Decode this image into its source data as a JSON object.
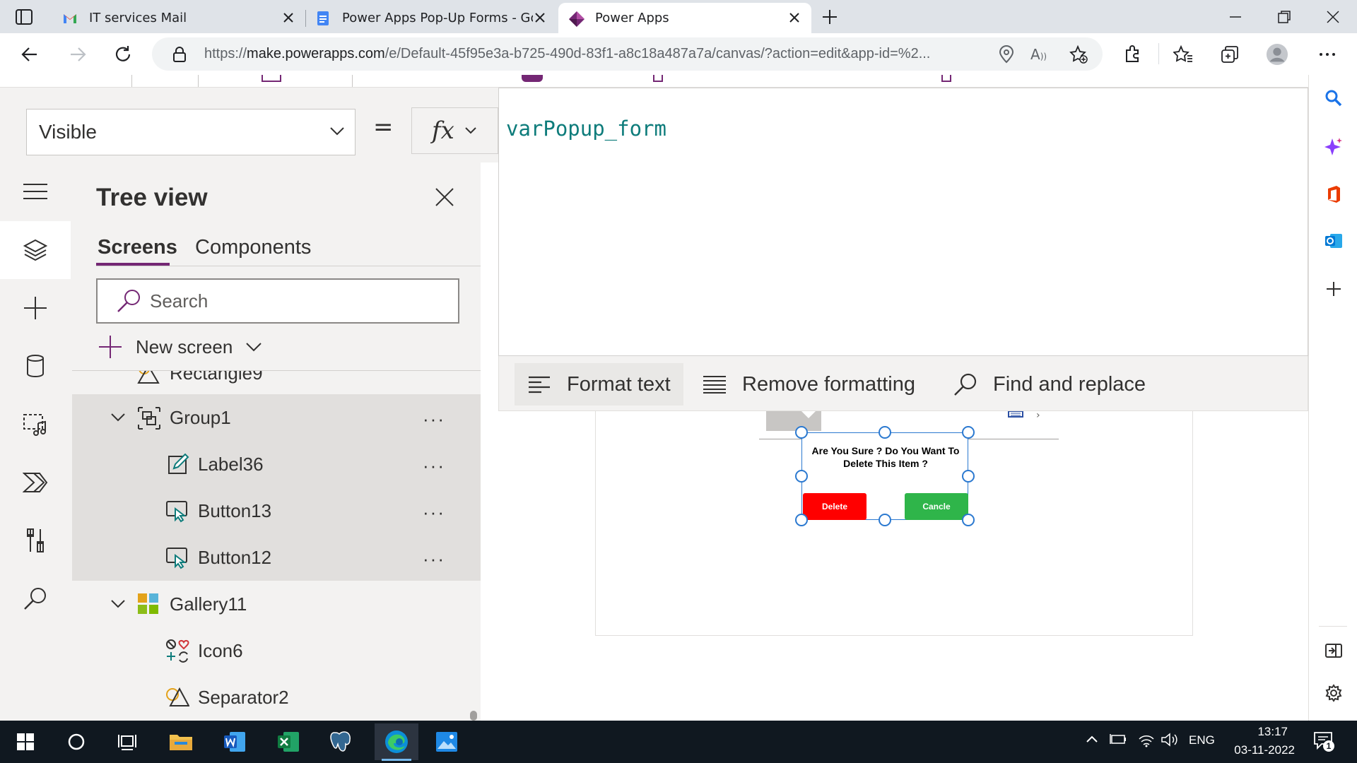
{
  "browser": {
    "tabs": [
      {
        "title": "IT services Mail",
        "icon": "gmail-icon"
      },
      {
        "title": "Power Apps Pop-Up Forms - Goo",
        "icon": "google-docs-icon"
      },
      {
        "title": "Power Apps",
        "icon": "power-apps-icon",
        "active": true
      }
    ],
    "url_prefix": "https://",
    "url_host": "make.powerapps.com",
    "url_rest": "/e/Default-45f95e3a-b725-490d-83f1-a8c18a487a7a/canvas/?action=edit&app-id=%2..."
  },
  "formula_bar": {
    "property": "Visible",
    "equals": "=",
    "fx": "fx",
    "formula": "varPopup_form"
  },
  "format_toolbar": {
    "format_text": "Format text",
    "remove_formatting": "Remove formatting",
    "find_replace": "Find and replace"
  },
  "tree_view": {
    "title": "Tree view",
    "tabs": [
      "Screens",
      "Components"
    ],
    "search_placeholder": "Search",
    "new_screen": "New screen",
    "items": [
      {
        "label": "Rectangle9",
        "icon": "shape-icon"
      },
      {
        "label": "Group1",
        "icon": "group-icon"
      },
      {
        "label": "Label36",
        "icon": "label-edit-icon"
      },
      {
        "label": "Button13",
        "icon": "button-icon"
      },
      {
        "label": "Button12",
        "icon": "button-icon"
      },
      {
        "label": "Gallery11",
        "icon": "gallery-icon"
      },
      {
        "label": "Icon6",
        "icon": "icons-icon"
      },
      {
        "label": "Separator2",
        "icon": "shape-icon"
      }
    ],
    "more": "···"
  },
  "canvas": {
    "popup_message": "Are You Sure ? Do You Want To Delete This Item ?",
    "delete_label": "Delete",
    "cancel_label": "Cancle",
    "delete_color": "#ff0000",
    "cancel_color": "#2fb54a"
  },
  "taskbar": {
    "language": "ENG",
    "time": "13:17",
    "date": "03-11-2022",
    "notification_count": "1"
  }
}
